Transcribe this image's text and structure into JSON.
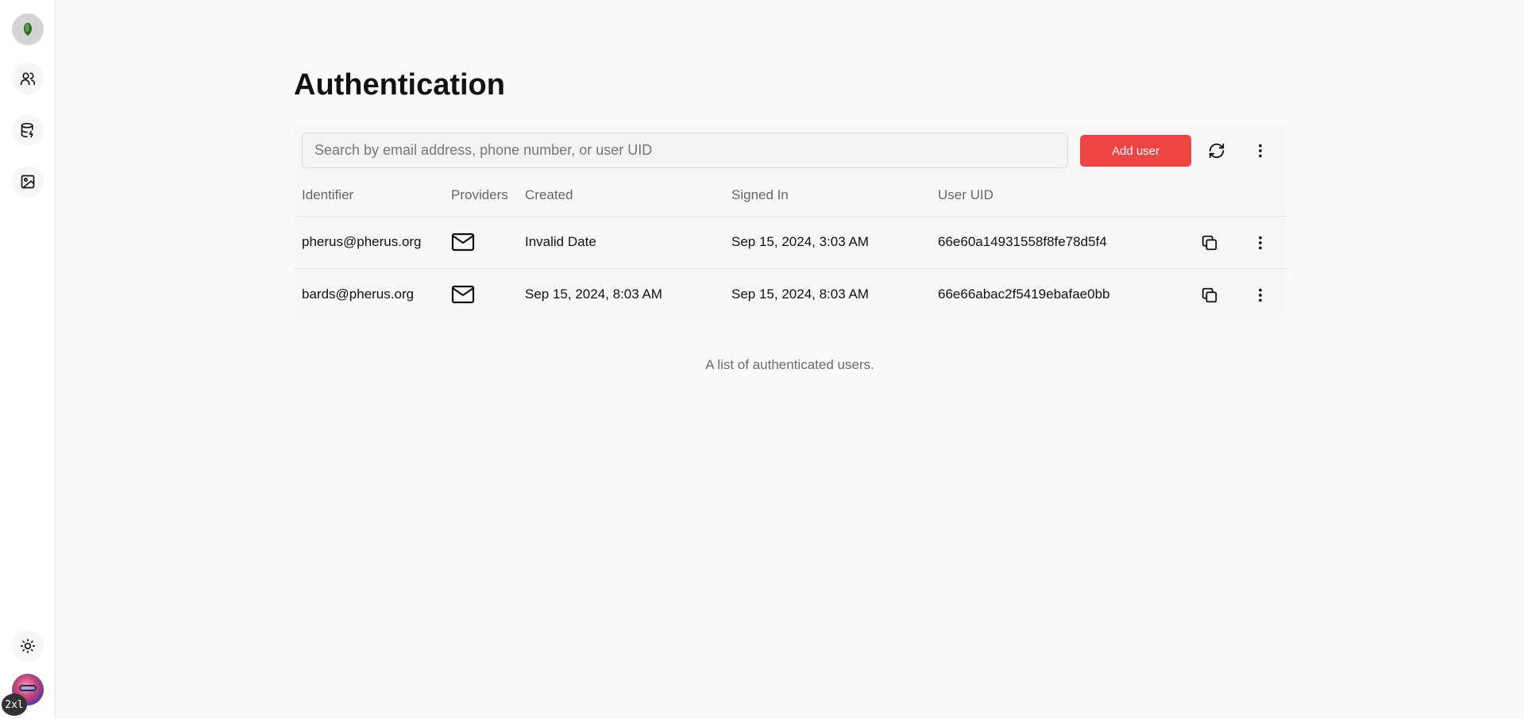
{
  "sidebar": {
    "items": [
      {
        "name": "logo",
        "icon": "leaf-logo-icon"
      },
      {
        "name": "users",
        "icon": "users-icon"
      },
      {
        "name": "database",
        "icon": "database-icon"
      },
      {
        "name": "storage",
        "icon": "image-icon"
      }
    ],
    "theme_icon": "sun-icon",
    "badge": "2xl"
  },
  "page": {
    "title": "Authentication"
  },
  "toolbar": {
    "search_placeholder": "Search by email address, phone number, or user UID",
    "search_value": "",
    "add_user_label": "Add user",
    "accent_color": "#ef4444"
  },
  "table": {
    "headers": [
      "Identifier",
      "Providers",
      "Created",
      "Signed In",
      "User UID"
    ],
    "rows": [
      {
        "identifier": "pherus@pherus.org",
        "provider": "email",
        "created": "Invalid Date",
        "signed_in": "Sep 15, 2024, 3:03 AM",
        "uid": "66e60a14931558f8fe78d5f4"
      },
      {
        "identifier": "bards@pherus.org",
        "provider": "email",
        "created": "Sep 15, 2024, 8:03 AM",
        "signed_in": "Sep 15, 2024, 8:03 AM",
        "uid": "66e66abac2f5419ebafae0bb"
      }
    ],
    "caption": "A list of authenticated users."
  }
}
